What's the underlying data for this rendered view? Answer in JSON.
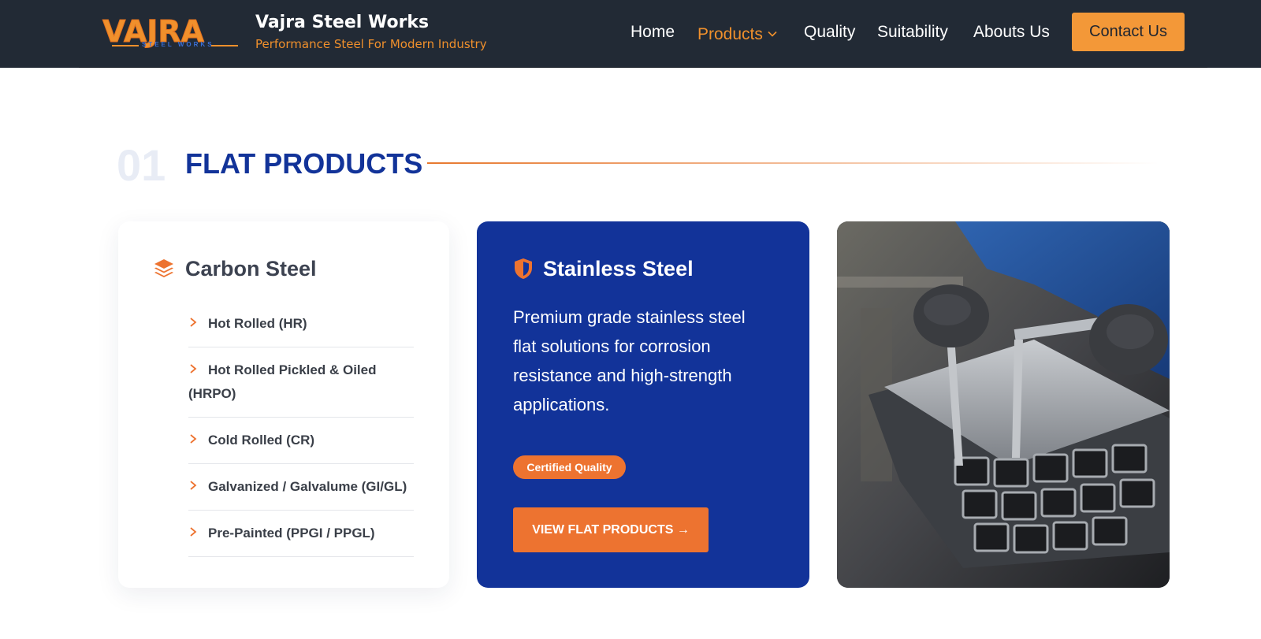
{
  "header": {
    "logo_text": "VAJRA",
    "logo_subtext": "STEEL WORKS",
    "brand_name": "Vajra Steel Works",
    "tagline": "Performance Steel For Modern Industry",
    "nav": [
      {
        "label": "Home"
      },
      {
        "label": "Products"
      },
      {
        "label": "Quality"
      },
      {
        "label": "Suitability"
      },
      {
        "label": "Abouts Us"
      }
    ],
    "contact_label": "Contact Us"
  },
  "section": {
    "number": "01",
    "title": "FLAT PRODUCTS"
  },
  "carbon": {
    "title": "Carbon Steel",
    "icon": "layers-icon",
    "items": [
      "Hot Rolled (HR)",
      "Hot Rolled Pickled & Oiled (HRPO)",
      "Cold Rolled (CR)",
      "Galvanized / Galvalume (GI/GL)",
      "Pre-Painted (PPGI / PPGL)"
    ]
  },
  "stainless": {
    "title": "Stainless Steel",
    "icon": "shield-icon",
    "description": "Premium grade stainless steel flat solutions for corrosion resistance and high-strength applications.",
    "badge": "Certified Quality",
    "button_label": "VIEW FLAT PRODUCTS →"
  },
  "colors": {
    "header_bg": "#222a35",
    "accent_orange": "#ed7330",
    "brand_blue": "#123399"
  }
}
